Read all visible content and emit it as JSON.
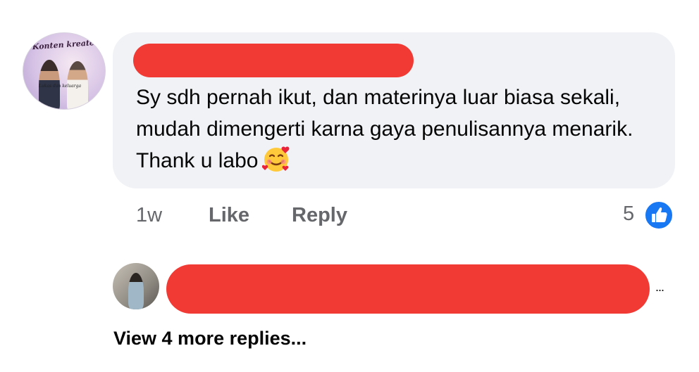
{
  "comment": {
    "avatar": {
      "banner_text": "Konten kreator",
      "caption_text": "Lukas dan keluarga"
    },
    "text": "Sy sdh pernah ikut, dan materinya luar biasa sekali, mudah dimengerti karna gaya penulisannya menarik. Thank u labo",
    "emoji": "smiling-face-with-hearts-icon",
    "time": "1w",
    "like_label": "Like",
    "reply_label": "Reply",
    "reaction_count": "5",
    "reaction_icon": "like-icon"
  },
  "reply_preview": {
    "more_label": "..."
  },
  "view_more_label": "View 4 more replies...",
  "colors": {
    "bubble": "#f0f2f5",
    "redaction": "#f23a35",
    "like_blue": "#1877f2",
    "muted_text": "#65676b"
  }
}
